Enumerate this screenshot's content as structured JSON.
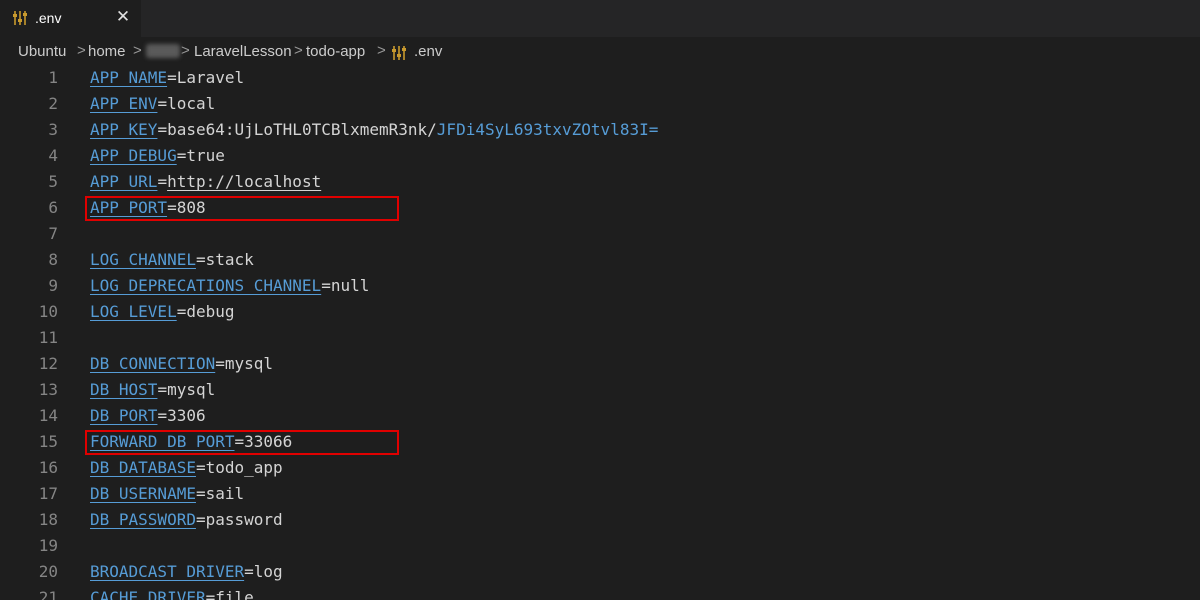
{
  "tab": {
    "label": ".env",
    "close": "✕"
  },
  "breadcrumb": {
    "items": [
      "Ubuntu",
      "home",
      "LaravelLesson",
      "todo-app",
      ".env"
    ],
    "separator": ">"
  },
  "colors": {
    "key": "#569cd6",
    "highlight": "#e00000",
    "icon": "#c99a2e"
  },
  "editor": {
    "lines": [
      {
        "n": "1",
        "key": "APP_NAME",
        "eq": "=",
        "val": "Laravel"
      },
      {
        "n": "2",
        "key": "APP_ENV",
        "eq": "=",
        "val": "local"
      },
      {
        "n": "3",
        "key": "APP_KEY",
        "eq": "=",
        "val": "base64:UjLoTHL0TCBlxmemR3nk/",
        "val2": "JFDi4SyL693txvZOtvl83I="
      },
      {
        "n": "4",
        "key": "APP_DEBUG",
        "eq": "=",
        "val": "true"
      },
      {
        "n": "5",
        "key": "APP_URL",
        "eq": "=",
        "val": "http://localhost"
      },
      {
        "n": "6",
        "key": "APP_PORT",
        "eq": "=",
        "val": "808"
      },
      {
        "n": "7"
      },
      {
        "n": "8",
        "key": "LOG_CHANNEL",
        "eq": "=",
        "val": "stack"
      },
      {
        "n": "9",
        "key": "LOG_DEPRECATIONS_CHANNEL",
        "eq": "=",
        "val": "null"
      },
      {
        "n": "10",
        "key": "LOG_LEVEL",
        "eq": "=",
        "val": "debug"
      },
      {
        "n": "11"
      },
      {
        "n": "12",
        "key": "DB_CONNECTION",
        "eq": "=",
        "val": "mysql"
      },
      {
        "n": "13",
        "key": "DB_HOST",
        "eq": "=",
        "val": "mysql"
      },
      {
        "n": "14",
        "key": "DB_PORT",
        "eq": "=",
        "val": "3306"
      },
      {
        "n": "15",
        "key": "FORWARD_DB_PORT",
        "eq": "=",
        "val": "33066"
      },
      {
        "n": "16",
        "key": "DB_DATABASE",
        "eq": "=",
        "val": "todo_app"
      },
      {
        "n": "17",
        "key": "DB_USERNAME",
        "eq": "=",
        "val": "sail"
      },
      {
        "n": "18",
        "key": "DB_PASSWORD",
        "eq": "=",
        "val": "password"
      },
      {
        "n": "19"
      },
      {
        "n": "20",
        "key": "BROADCAST_DRIVER",
        "eq": "=",
        "val": "log"
      },
      {
        "n": "21",
        "key": "CACHE_DRIVER",
        "eq": "=",
        "val": "file"
      }
    ]
  }
}
